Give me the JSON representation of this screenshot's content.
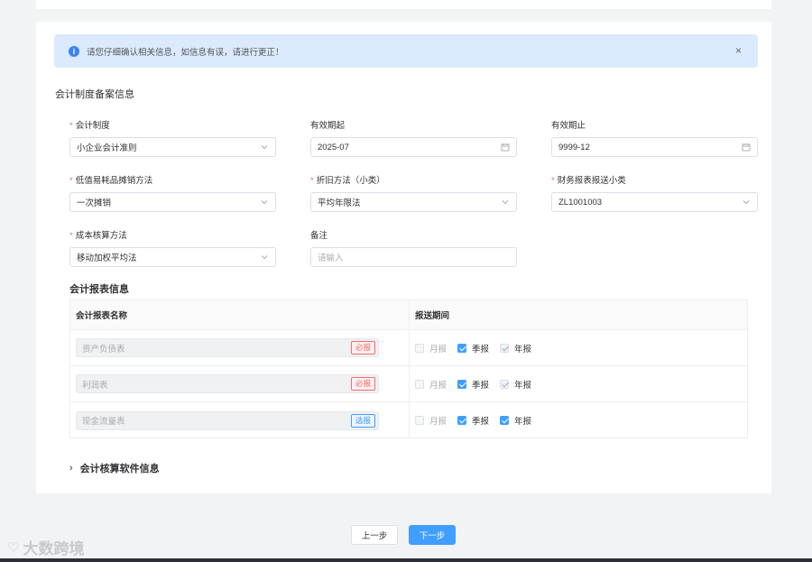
{
  "alert": {
    "text": "请您仔细确认相关信息，如信息有误，请进行更正！",
    "close": "×"
  },
  "section_title": "会计制度备案信息",
  "fields": {
    "accounting_system": {
      "label": "会计制度",
      "required": "*",
      "value": "小企业会计准则"
    },
    "valid_from": {
      "label": "有效期起",
      "value": "2025-07"
    },
    "valid_to": {
      "label": "有效期止",
      "value": "9999-12"
    },
    "low_value_method": {
      "label": "低值易耗品摊销方法",
      "required": "*",
      "value": "一次摊销"
    },
    "depreciation": {
      "label": "折旧方法（小类）",
      "required": "*",
      "value": "平均年限法"
    },
    "report_subclass": {
      "label": "财务报表报送小类",
      "required": "*",
      "value": "ZL1001003"
    },
    "cost_method": {
      "label": "成本核算方法",
      "required": "*",
      "value": "移动加权平均法"
    },
    "remark": {
      "label": "备注",
      "placeholder": "请输入"
    }
  },
  "report_section_title": "会计报表信息",
  "table": {
    "headers": [
      "会计报表名称",
      "报送期间"
    ],
    "rows": [
      {
        "name": "资产负债表",
        "tag": "必报",
        "monthly": "月报",
        "quarterly": "季报",
        "annual": "年报"
      },
      {
        "name": "利润表",
        "tag": "必报",
        "monthly": "月报",
        "quarterly": "季报",
        "annual": "年报"
      },
      {
        "name": "现金流量表",
        "tag": "选报",
        "monthly": "月报",
        "quarterly": "季报",
        "annual": "年报"
      }
    ]
  },
  "collapse_title": "会计核算软件信息",
  "buttons": {
    "prev": "上一步",
    "next": "下一步"
  },
  "watermark": "大数跨境",
  "colors": {
    "primary": "#409eff",
    "required": "#f56c6c",
    "alert_bg": "#dbeafe"
  }
}
